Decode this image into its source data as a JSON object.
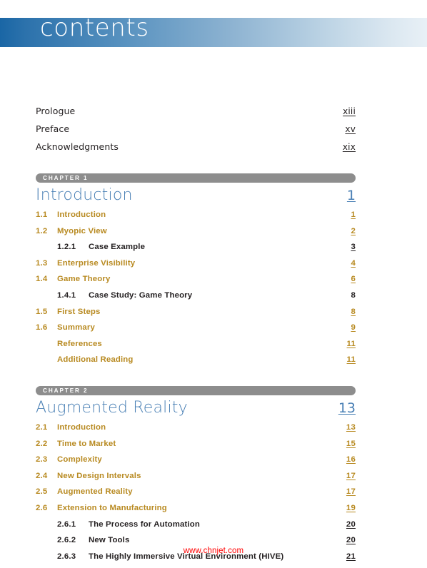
{
  "page": {
    "header_title": "contents",
    "watermark": "www.chnjet.com",
    "colors": {
      "band_start": "#1a66a5",
      "band_end": "#e8f0f6",
      "chapter_bar": "#8d8d8d",
      "chapter_title": "#4a80b5",
      "section_gold": "#b88a21",
      "subsection_black": "#231f20",
      "watermark_red": "#ff0000"
    }
  },
  "front_matter": [
    {
      "title": "Prologue",
      "page": "xiii"
    },
    {
      "title": "Preface",
      "page": "xv"
    },
    {
      "title": "Acknowledgments",
      "page": "xix"
    }
  ],
  "chapters": [
    {
      "bar_label": "CHAPTER 1",
      "title": "Introduction",
      "page": "1",
      "entries": [
        {
          "level": 2,
          "num": "1.1",
          "label": "Introduction",
          "page": "1",
          "underline": true
        },
        {
          "level": 2,
          "num": "1.2",
          "label": "Myopic View",
          "page": "2",
          "underline": true
        },
        {
          "level": 3,
          "num": "1.2.1",
          "label": "Case Example",
          "page": "3",
          "underline": true
        },
        {
          "level": 2,
          "num": "1.3",
          "label": "Enterprise Visibility",
          "page": "4",
          "underline": true
        },
        {
          "level": 2,
          "num": "1.4",
          "label": "Game Theory",
          "page": "6",
          "underline": true
        },
        {
          "level": 3,
          "num": "1.4.1",
          "label": "Case Study: Game Theory",
          "page": "8",
          "underline": false
        },
        {
          "level": 2,
          "num": "1.5",
          "label": "First Steps",
          "page": "8",
          "underline": true
        },
        {
          "level": 2,
          "num": "1.6",
          "label": "Summary",
          "page": "9",
          "underline": true
        },
        {
          "level": 2,
          "num": "",
          "label": "References",
          "page": "11",
          "underline": true
        },
        {
          "level": 2,
          "num": "",
          "label": "Additional Reading",
          "page": "11",
          "underline": true
        }
      ]
    },
    {
      "bar_label": "CHAPTER 2",
      "title": "Augmented Reality",
      "page": "13",
      "entries": [
        {
          "level": 2,
          "num": "2.1",
          "label": "Introduction",
          "page": "13",
          "underline": true
        },
        {
          "level": 2,
          "num": "2.2",
          "label": "Time to Market",
          "page": "15",
          "underline": true
        },
        {
          "level": 2,
          "num": "2.3",
          "label": "Complexity",
          "page": "16",
          "underline": true
        },
        {
          "level": 2,
          "num": "2.4",
          "label": "New Design Intervals",
          "page": "17",
          "underline": true
        },
        {
          "level": 2,
          "num": "2.5",
          "label": "Augmented Reality",
          "page": "17",
          "underline": true
        },
        {
          "level": 2,
          "num": "2.6",
          "label": "Extension to Manufacturing",
          "page": "19",
          "underline": true
        },
        {
          "level": 3,
          "num": "2.6.1",
          "label": "The Process for Automation",
          "page": "20",
          "underline": true
        },
        {
          "level": 3,
          "num": "2.6.2",
          "label": "New Tools",
          "page": "20",
          "underline": true
        },
        {
          "level": 3,
          "num": "2.6.3",
          "label": "The Highly Immersive Virtual Environment (HIVE)",
          "page": "21",
          "underline": true
        }
      ]
    }
  ]
}
